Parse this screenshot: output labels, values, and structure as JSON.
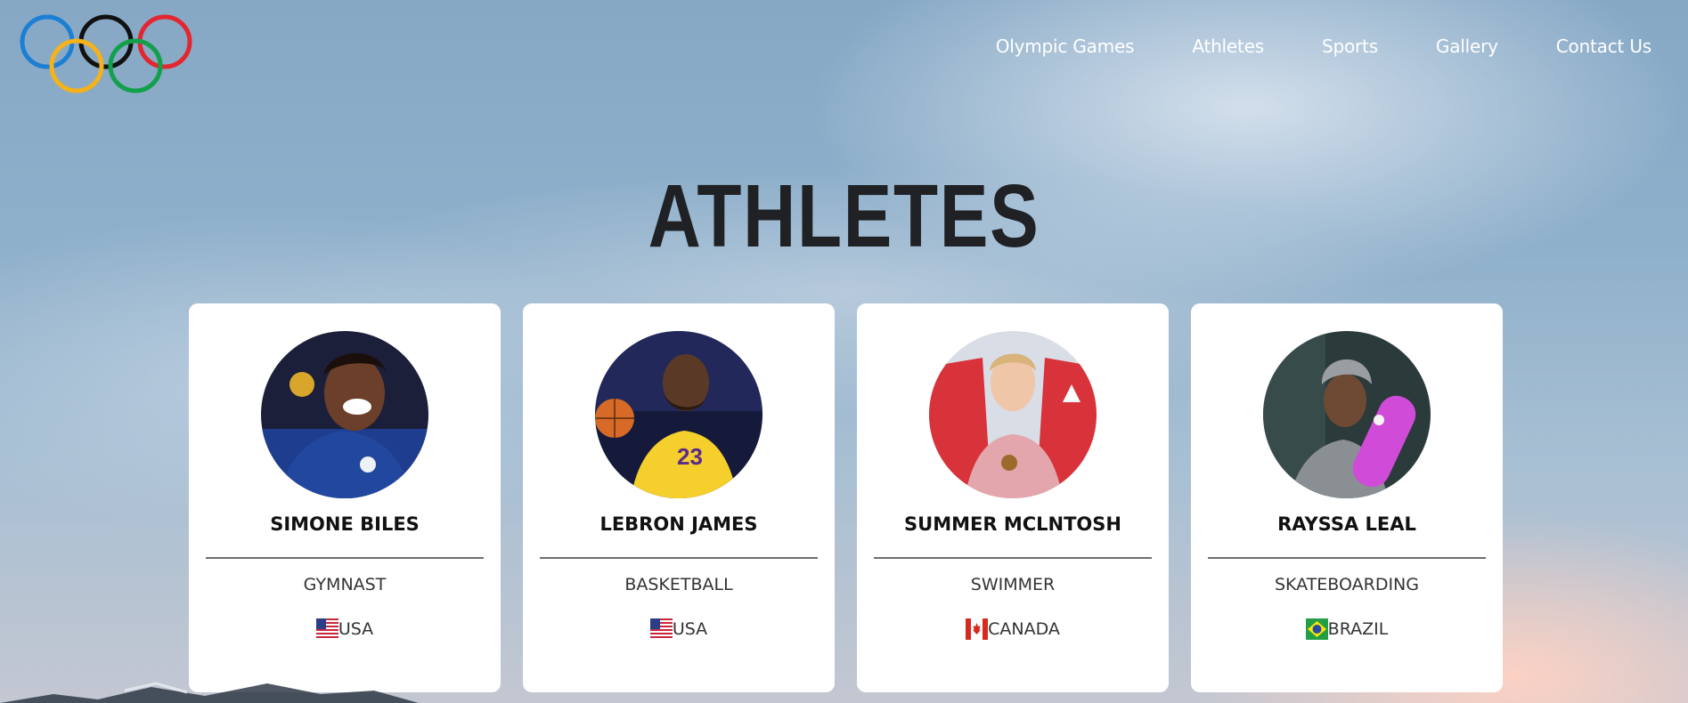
{
  "nav": {
    "items": [
      {
        "label": "Olympic Games"
      },
      {
        "label": "Athletes"
      },
      {
        "label": "Sports"
      },
      {
        "label": "Gallery"
      },
      {
        "label": "Contact Us"
      }
    ]
  },
  "page": {
    "title": "ATHLETES"
  },
  "logo": {
    "icon": "olympic-rings-icon",
    "ring_colors": [
      "#1b7fd4",
      "#111111",
      "#e3262f",
      "#f5b21a",
      "#12a04a"
    ]
  },
  "athletes": [
    {
      "name": "SIMONE BILES",
      "sport": "GYMNAST",
      "country": "USA",
      "flag_icon": "usa-flag-icon"
    },
    {
      "name": "LEBRON JAMES",
      "sport": "BASKETBALL",
      "country": "USA",
      "flag_icon": "usa-flag-icon"
    },
    {
      "name": "SUMMER MCLNTOSH",
      "sport": "SWIMMER",
      "country": "CANADA",
      "flag_icon": "canada-flag-icon"
    },
    {
      "name": "RAYSSA LEAL",
      "sport": "SKATEBOARDING",
      "country": "BRAZIL",
      "flag_icon": "brazil-flag-icon"
    }
  ]
}
